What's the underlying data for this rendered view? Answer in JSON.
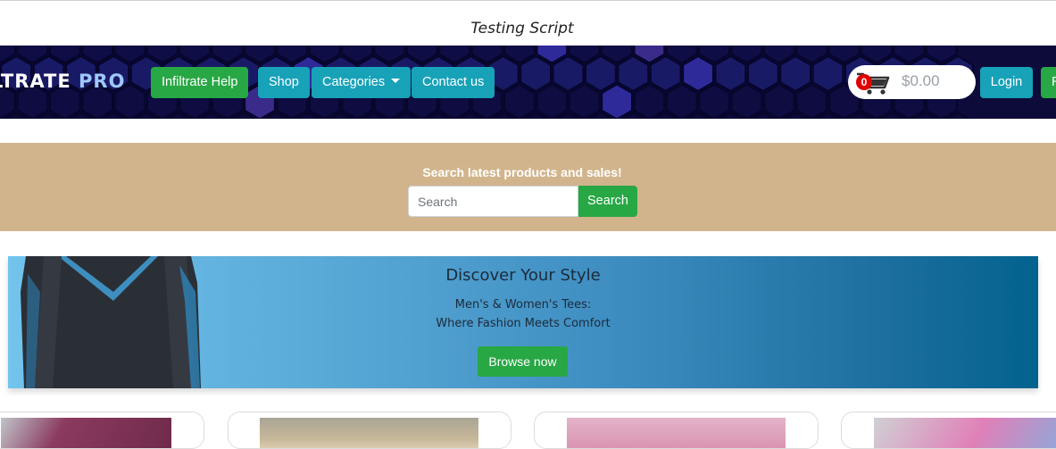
{
  "page": {
    "title": "Testing Script"
  },
  "navbar": {
    "logo_main": "LTRATE ",
    "logo_accent": "PRO",
    "buttons": {
      "help": "Infiltrate Help",
      "shop": "Shop",
      "categories": "Categories",
      "contact": "Contact us",
      "login": "Login",
      "partial": "R"
    },
    "cart": {
      "count": "0",
      "total": "$0.00",
      "icon": "shopping-cart-icon"
    }
  },
  "search": {
    "heading": "Search latest products and sales!",
    "placeholder": "Search",
    "button": "Search"
  },
  "hero": {
    "title": "Discover Your Style",
    "line1": "Men's & Women's Tees:",
    "line2": "Where Fashion Meets Comfort",
    "button": "Browse now"
  },
  "colors": {
    "green": "#28a745",
    "teal": "#17a2b8",
    "search_band": "#d2b48c",
    "cart_badge": "#e00000"
  }
}
